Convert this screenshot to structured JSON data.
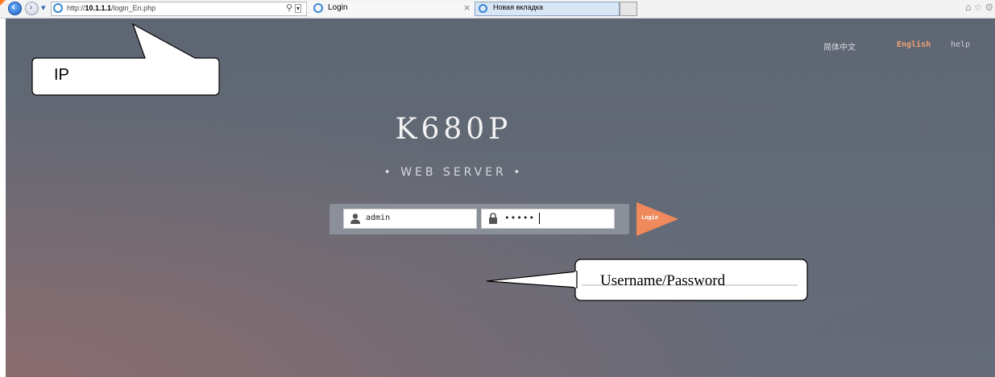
{
  "browser": {
    "address": {
      "prefix": "http://",
      "host": "10.1.1.1",
      "path": "/login_En.php"
    },
    "tabs": [
      {
        "label": "Login",
        "active": true
      },
      {
        "label": "Новая вкладка",
        "active": false
      }
    ],
    "icons": [
      "back-arrow-icon",
      "forward-arrow-icon",
      "history-dropdown-icon",
      "search-icon",
      "refresh-icon",
      "home-icon",
      "star-icon",
      "gear-icon"
    ]
  },
  "page": {
    "languages": {
      "chinese": "简体中文",
      "english": "English",
      "help": "help"
    },
    "product_title": "K680P",
    "subtitle": "• WEB SERVER •",
    "login": {
      "username_value": "admin",
      "password_masked": "•••••",
      "button_label": "Login"
    },
    "colors": {
      "accent": "#f08a5d",
      "background": "#636a76"
    }
  },
  "annotations": {
    "ip_label": "IP",
    "credentials_label": "Username/Password"
  }
}
